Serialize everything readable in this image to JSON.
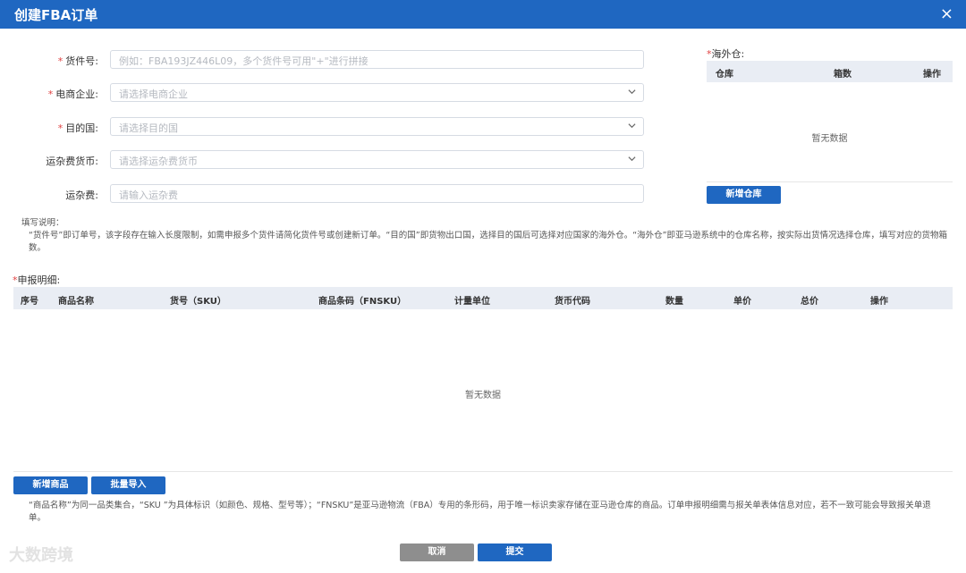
{
  "window": {
    "title": "创建FBA订单",
    "close_glyph": "×"
  },
  "form": {
    "fields": [
      {
        "label": "货件号:",
        "required": "*",
        "placeholder": "例如：FBA193JZ446L09，多个货件号可用\"+\"进行拼接",
        "type": "text"
      },
      {
        "label": "电商企业:",
        "required": "*",
        "placeholder": "请选择电商企业",
        "type": "select"
      },
      {
        "label": "目的国:",
        "required": "*",
        "placeholder": "请选择目的国",
        "type": "select"
      },
      {
        "label": "运杂费货币:",
        "required": "",
        "placeholder": "请选择运杂费货币",
        "type": "select"
      },
      {
        "label": "运杂费:",
        "required": "",
        "placeholder": "请输入运杂费",
        "type": "text"
      }
    ]
  },
  "warehouse": {
    "required": "*",
    "label": "海外仓:",
    "columns": [
      "仓库",
      "箱数",
      "操作"
    ],
    "empty_text": "暂无数据",
    "add_button": "新增仓库"
  },
  "notes": {
    "title": "填写说明：",
    "body": "“货件号”即订单号，该字段存在输入长度限制，如需申报多个货件请简化货件号或创建新订单。“目的国”即货物出口国，选择目的国后可选择对应国家的海外仓。“海外仓”即亚马逊系统中的仓库名称，按实际出货情况选择仓库，填写对应的货物箱数。"
  },
  "details": {
    "required": "*",
    "label": "申报明细:",
    "columns": [
      "序号",
      "商品名称",
      "货号（SKU）",
      "商品条码（FNSKU）",
      "计量单位",
      "货币代码",
      "数量",
      "单价",
      "总价",
      "操作"
    ],
    "empty_text": "暂无数据",
    "add_button": "新增商品",
    "import_button": "批量导入",
    "footnote": "“商品名称”为同一品类集合，“SKU ”为具体标识（如颜色、规格、型号等）；“FNSKU”是亚马逊物流（FBA）专用的条形码，用于唯一标识卖家存储在亚马逊仓库的商品。订单申报明细需与报关单表体信息对应，若不一致可能会导致报关单退单。"
  },
  "actions": {
    "cancel": "取消",
    "submit": "提交"
  },
  "watermark": {
    "text": "大数跨境"
  },
  "colors": {
    "primary": "#1f67c1",
    "required": "#e04141",
    "header_bg": "#e9edf4",
    "cancel": "#8e8e8e"
  },
  "icons": {
    "close": "close-icon",
    "dropdown": "chevron-down-icon"
  }
}
